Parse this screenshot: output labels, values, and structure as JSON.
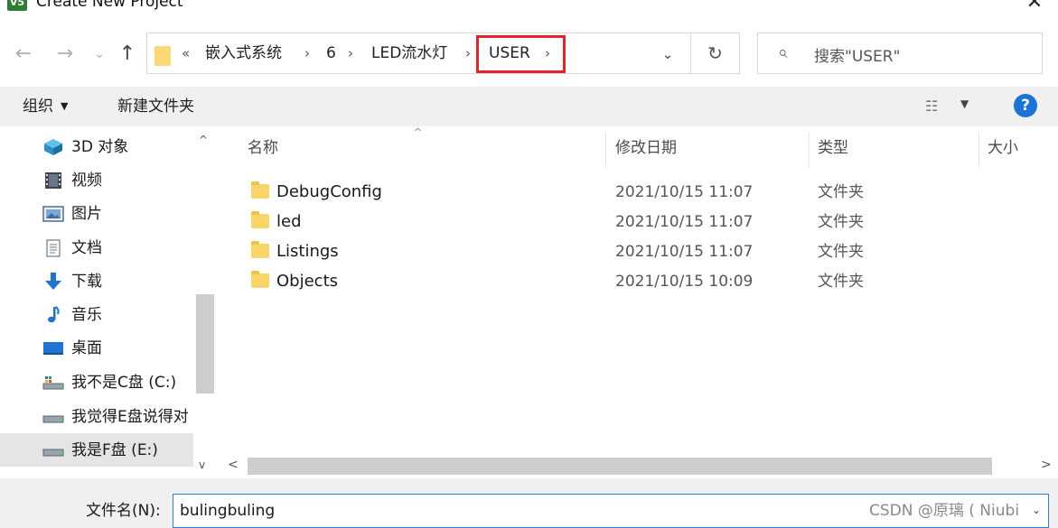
{
  "window": {
    "title": "Create New Project",
    "app_icon_text": "V5"
  },
  "nav": {
    "back": "←",
    "forward": "→",
    "recent": "⌄",
    "up": "↑"
  },
  "address": {
    "overflow": "«",
    "crumbs": [
      "嵌入式系统",
      "6",
      "LED流水灯",
      "USER"
    ],
    "separator": "›",
    "dropdown": "⌄",
    "refresh": "↻"
  },
  "search": {
    "icon": "⌕",
    "placeholder": "搜索\"USER\""
  },
  "toolbar": {
    "organize": "组织",
    "new_folder": "新建文件夹",
    "caret": "▼",
    "view_icon": "☷",
    "help": "?"
  },
  "sidebar": {
    "items": [
      {
        "label": "3D 对象",
        "icon": "cube-icon"
      },
      {
        "label": "视频",
        "icon": "video-icon"
      },
      {
        "label": "图片",
        "icon": "picture-icon"
      },
      {
        "label": "文档",
        "icon": "document-icon"
      },
      {
        "label": "下载",
        "icon": "download-icon"
      },
      {
        "label": "音乐",
        "icon": "music-icon"
      },
      {
        "label": "桌面",
        "icon": "desktop-icon"
      },
      {
        "label": "我不是C盘 (C:)",
        "icon": "drive-icon"
      },
      {
        "label": "我觉得E盘说得对",
        "icon": "drive-icon"
      },
      {
        "label": "我是F盘 (E:)",
        "icon": "drive-icon",
        "selected": true
      }
    ],
    "scroll_up": "^",
    "scroll_down": "v"
  },
  "columns": {
    "name": "名称",
    "modified": "修改日期",
    "type": "类型",
    "size": "大小"
  },
  "files": [
    {
      "name": "DebugConfig",
      "modified": "2021/10/15 11:07",
      "type": "文件夹"
    },
    {
      "name": "led",
      "modified": "2021/10/15 11:07",
      "type": "文件夹"
    },
    {
      "name": "Listings",
      "modified": "2021/10/15 11:07",
      "type": "文件夹"
    },
    {
      "name": "Objects",
      "modified": "2021/10/15 10:09",
      "type": "文件夹"
    }
  ],
  "hscroll": {
    "left": "<",
    "right": ">"
  },
  "filename": {
    "label": "文件名(N):",
    "value": "bulingbuling",
    "caret": "⌄"
  },
  "watermark": "CSDN @原璃 ( Niubi",
  "colors": {
    "highlight_border": "#e3242b",
    "folder": "#f8d469",
    "input_border": "#2b7de0",
    "help": "#1a73d6"
  }
}
